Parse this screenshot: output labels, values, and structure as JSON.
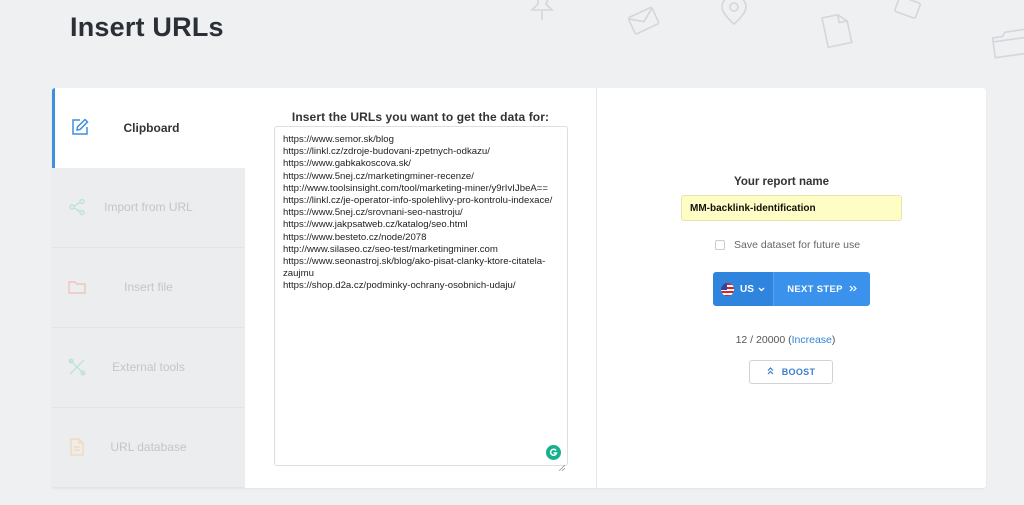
{
  "page": {
    "title": "Insert URLs"
  },
  "tabs": [
    {
      "label": "Clipboard",
      "icon": "edit-icon",
      "active": true
    },
    {
      "label": "Import from URL",
      "icon": "share-icon",
      "active": false
    },
    {
      "label": "Insert file",
      "icon": "folder-icon",
      "active": false
    },
    {
      "label": "External tools",
      "icon": "tools-icon",
      "active": false
    },
    {
      "label": "URL database",
      "icon": "document-icon",
      "active": false
    }
  ],
  "input": {
    "heading": "Insert the URLs you want to get the data for:",
    "urls": "https://www.semor.sk/blog\nhttps://linkl.cz/zdroje-budovani-zpetnych-odkazu/\nhttps://www.gabkakoscova.sk/\nhttps://www.5nej.cz/marketingminer-recenze/\nhttp://www.toolsinsight.com/tool/marketing-miner/y9rIvIJbeA==\nhttps://linkl.cz/je-operator-info-spolehlivy-pro-kontrolu-indexace/\nhttps://www.5nej.cz/srovnani-seo-nastroju/\nhttps://www.jakpsatweb.cz/katalog/seo.html\nhttps://www.besteto.cz/node/2078\nhttp://www.silaseo.cz/seo-test/marketingminer.com\nhttps://www.seonastroj.sk/blog/ako-pisat-clanky-ktore-citatela-zaujmu\nhttps://shop.d2a.cz/podminky-ochrany-osobnich-udaju/"
  },
  "report": {
    "label": "Your report name",
    "name": "MM-backlink-identification",
    "save_label": "Save dataset for future use",
    "country": "US",
    "next_label": "NEXT STEP",
    "counter": "12 / 20000 (",
    "increase_label": "Increase",
    "counter_end": ")",
    "boost_label": "BOOST"
  },
  "colors": {
    "accent": "#3a92ec",
    "active_tab_border": "#3d8fe0",
    "input_highlight": "#fdfdc4"
  }
}
